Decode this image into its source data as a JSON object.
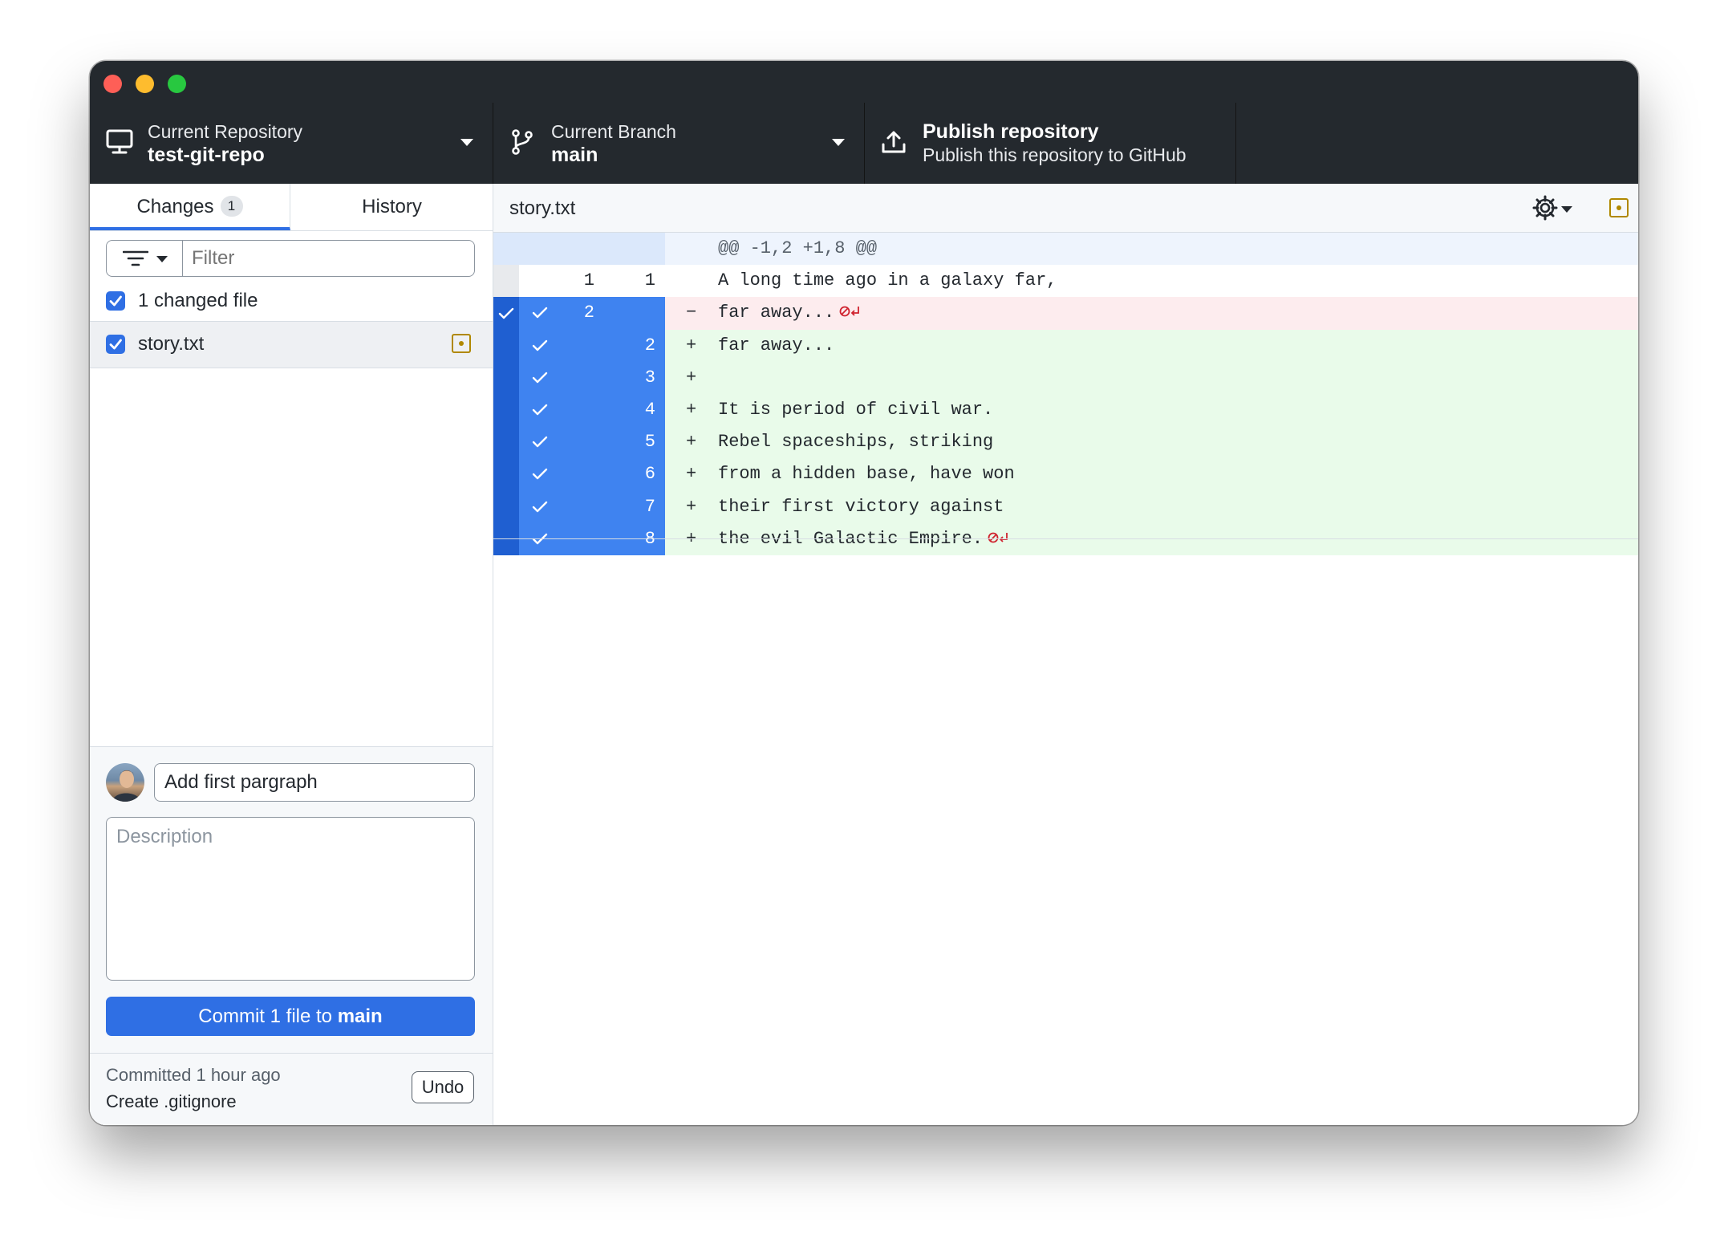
{
  "toolbar": {
    "repository": {
      "label": "Current Repository",
      "value": "test-git-repo"
    },
    "branch": {
      "label": "Current Branch",
      "value": "main"
    },
    "publish": {
      "title": "Publish repository",
      "subtitle": "Publish this repository to GitHub"
    }
  },
  "sidebar": {
    "tabs": [
      {
        "label": "Changes",
        "badge": "1"
      },
      {
        "label": "History"
      }
    ],
    "filter_placeholder": "Filter",
    "changed_files_label": "1 changed file",
    "files": [
      {
        "name": "story.txt",
        "status": "modified"
      }
    ]
  },
  "commit": {
    "summary": "Add first pargraph",
    "description_placeholder": "Description",
    "button_prefix": "Commit 1 file to ",
    "button_branch": "main"
  },
  "last_commit": {
    "when": "Committed 1 hour ago",
    "message": "Create .gitignore",
    "undo_label": "Undo"
  },
  "diff": {
    "filename": "story.txt",
    "hunk_header": "@@ -1,2 +1,8 @@",
    "lines": [
      {
        "type": "context",
        "old": "1",
        "new": "1",
        "marker": "",
        "text": "A long time ago in a galaxy far,"
      },
      {
        "type": "deleted",
        "old": "2",
        "new": "",
        "marker": "−",
        "text": "far away...",
        "no_newline": true
      },
      {
        "type": "added",
        "old": "",
        "new": "2",
        "marker": "+",
        "text": "far away..."
      },
      {
        "type": "added",
        "old": "",
        "new": "3",
        "marker": "+",
        "text": ""
      },
      {
        "type": "added",
        "old": "",
        "new": "4",
        "marker": "+",
        "text": "It is period of civil war."
      },
      {
        "type": "added",
        "old": "",
        "new": "5",
        "marker": "+",
        "text": "Rebel spaceships, striking"
      },
      {
        "type": "added",
        "old": "",
        "new": "6",
        "marker": "+",
        "text": "from a hidden base, have won"
      },
      {
        "type": "added",
        "old": "",
        "new": "7",
        "marker": "+",
        "text": "their first victory against"
      },
      {
        "type": "added",
        "old": "",
        "new": "8",
        "marker": "+",
        "text": "the evil Galactic Empire.",
        "no_newline": true
      }
    ]
  },
  "colors": {
    "accent": "#2f6fe4",
    "selection": "#3f83f0",
    "added_bg": "#e9fbea",
    "deleted_bg": "#fdecee",
    "modified": "#b08800"
  }
}
